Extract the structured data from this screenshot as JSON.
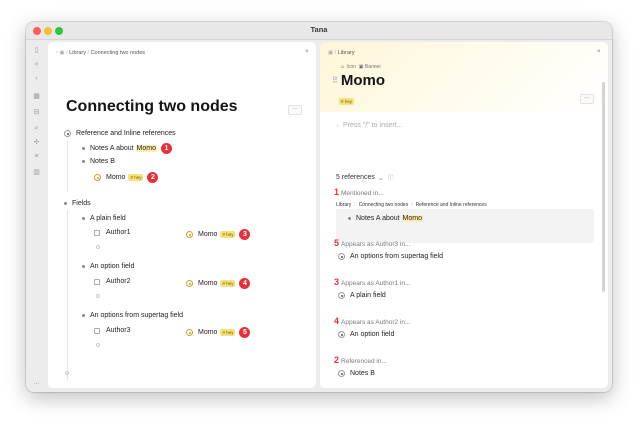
{
  "window": {
    "title": "Tana"
  },
  "sidebar": {
    "icons": [
      "panel-icon",
      "back-icon",
      "nav-icon",
      "calendar-icon",
      "inbox-icon",
      "search-icon",
      "settings-icon",
      "library-icon",
      "stats-icon",
      "more-icon"
    ]
  },
  "left": {
    "breadcrumb": {
      "part1": "Library",
      "sep": "/",
      "part2": "Connecting two nodes"
    },
    "close": "×",
    "title": "Connecting two nodes",
    "more": "···",
    "ref_heading": "Reference and Inline references",
    "notes_a": {
      "text": "Notes A about",
      "mention": "Momo",
      "badge": "1"
    },
    "notes_b": {
      "text": "Notes B"
    },
    "momo_ref": {
      "text": "Momo",
      "tag": "# hey",
      "badge": "2"
    },
    "fields_heading": "Fields",
    "plain_field": {
      "label": "A plain field",
      "field": "Author1",
      "value": "Momo",
      "tag": "# hey",
      "badge": "3"
    },
    "option_field": {
      "label": "An option field",
      "field": "Author2",
      "value": "Momo",
      "tag": "# hey",
      "badge": "4"
    },
    "supertag_field": {
      "label": "An options from supertag field",
      "field": "Author3",
      "value": "Momo",
      "tag": "# hey",
      "badge": "5"
    }
  },
  "right": {
    "breadcrumb": {
      "part1": "Library"
    },
    "close": "×",
    "icon_btn": "Icon",
    "banner_btn": "Banner",
    "title": "Momo",
    "tag": "# hey",
    "more": "···",
    "placeholder": "Press \"/\" to insert...",
    "refs_count": "5 references",
    "sections": [
      {
        "num": "1",
        "label": "Mentioned in...",
        "path": [
          "Library",
          "Connecting two nodes",
          "Reference and Inline references"
        ],
        "item": "Notes A about",
        "mention": "Momo"
      },
      {
        "num": "5",
        "label": "Appears as Author3 in...",
        "item": "An options from supertag field"
      },
      {
        "num": "3",
        "label": "Appears as Author1 in...",
        "item": "A plain field"
      },
      {
        "num": "4",
        "label": "Appears as Author2 in...",
        "item": "An option field"
      },
      {
        "num": "2",
        "label": "Referenced in...",
        "item": "Notes B"
      }
    ]
  },
  "colors": {
    "accent_red": "#e8303a",
    "tag_yellow": "#f6e27a",
    "highlight": "#fbeeb0"
  }
}
